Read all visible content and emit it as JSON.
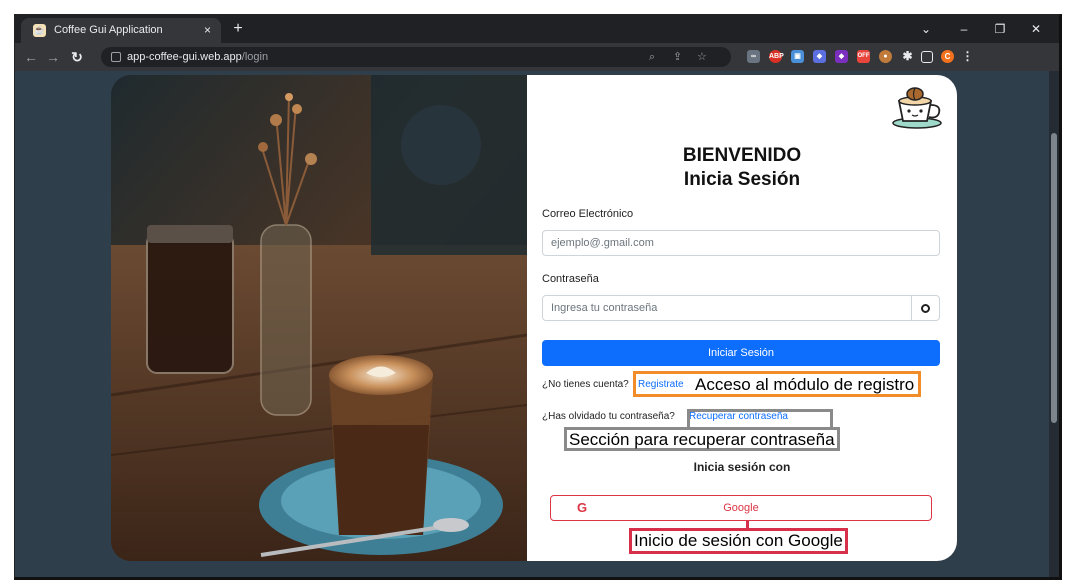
{
  "browser": {
    "tab_title": "Coffee Gui Application",
    "tab_close": "×",
    "new_tab": "+",
    "url_host": "app-coffee-gui.web.app",
    "url_path": "/login",
    "window_minimize": "–",
    "window_restore": "❐",
    "window_close": "✕",
    "tab_search": "⌄",
    "ext_abp": "ABP",
    "ext_off": "OFF",
    "profile_initial": "C"
  },
  "login": {
    "title_line1": "BIENVENIDO",
    "title_line2": "Inicia Sesión",
    "email_label": "Correo Electrónico",
    "email_placeholder": "ejemplo@.gmail.com",
    "password_label": "Contraseña",
    "password_placeholder": "Ingresa tu contraseña",
    "submit_label": "Iniciar Sesión",
    "no_account_text": "¿No tienes cuenta?",
    "register_link": "Registrate",
    "forgot_text": "¿Has olvidado tu contraseña?",
    "recover_link": "Recuperar contraseña",
    "login_with": "Inicia sesión con",
    "google_label": "Google",
    "google_letter": "G"
  },
  "annotations": {
    "register": "Acceso al módulo de registro",
    "recover": "Sección para recuperar contraseña",
    "google": "Inicio de sesión con Google"
  },
  "colors": {
    "primary": "#0d6efd",
    "google_red": "#dc3545",
    "annotation_orange": "#f28c28",
    "annotation_gray": "#8a8a8a",
    "annotation_red": "#d6304a",
    "page_background": "#2f3e4b"
  }
}
